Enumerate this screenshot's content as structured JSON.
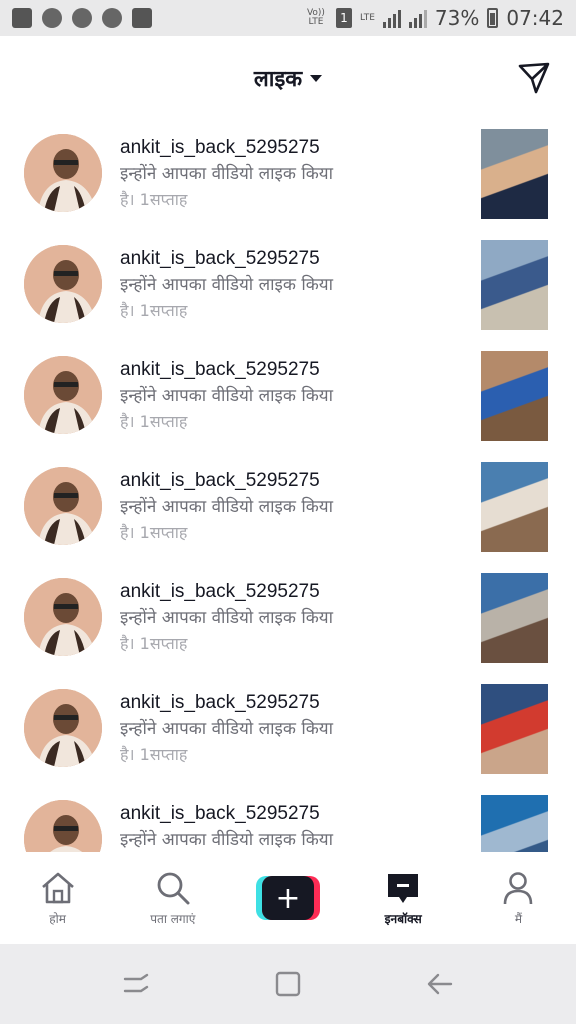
{
  "status_bar": {
    "volte_label": "Vo)) LTE",
    "sim_number": "1",
    "lte_label": "LTE",
    "battery_text": "73%",
    "time": "07:42"
  },
  "header": {
    "title": "लाइक"
  },
  "notifications": [
    {
      "username": "ankit_is_back_5295275",
      "message": "इन्होंने आपका वीडियो लाइक किया",
      "time": "है। 1सप्ताह"
    },
    {
      "username": "ankit_is_back_5295275",
      "message": "इन्होंने आपका वीडियो लाइक किया",
      "time": "है। 1सप्ताह"
    },
    {
      "username": "ankit_is_back_5295275",
      "message": "इन्होंने आपका वीडियो लाइक किया",
      "time": "है। 1सप्ताह"
    },
    {
      "username": "ankit_is_back_5295275",
      "message": "इन्होंने आपका वीडियो लाइक किया",
      "time": "है। 1सप्ताह"
    },
    {
      "username": "ankit_is_back_5295275",
      "message": "इन्होंने आपका वीडियो लाइक किया",
      "time": "है। 1सप्ताह"
    },
    {
      "username": "ankit_is_back_5295275",
      "message": "इन्होंने आपका वीडियो लाइक किया",
      "time": "है। 1सप्ताह"
    },
    {
      "username": "ankit_is_back_5295275",
      "message": "इन्होंने आपका वीडियो लाइक किया",
      "time": ""
    }
  ],
  "bottom_nav": {
    "home": "होम",
    "discover": "पता लगाएं",
    "inbox": "इनबॉक्स",
    "me": "मैं"
  },
  "colors": {
    "accent_red": "#fe2c55",
    "accent_cyan": "#3ee0e4",
    "text_primary": "#161823",
    "text_secondary": "#6d6e76"
  }
}
